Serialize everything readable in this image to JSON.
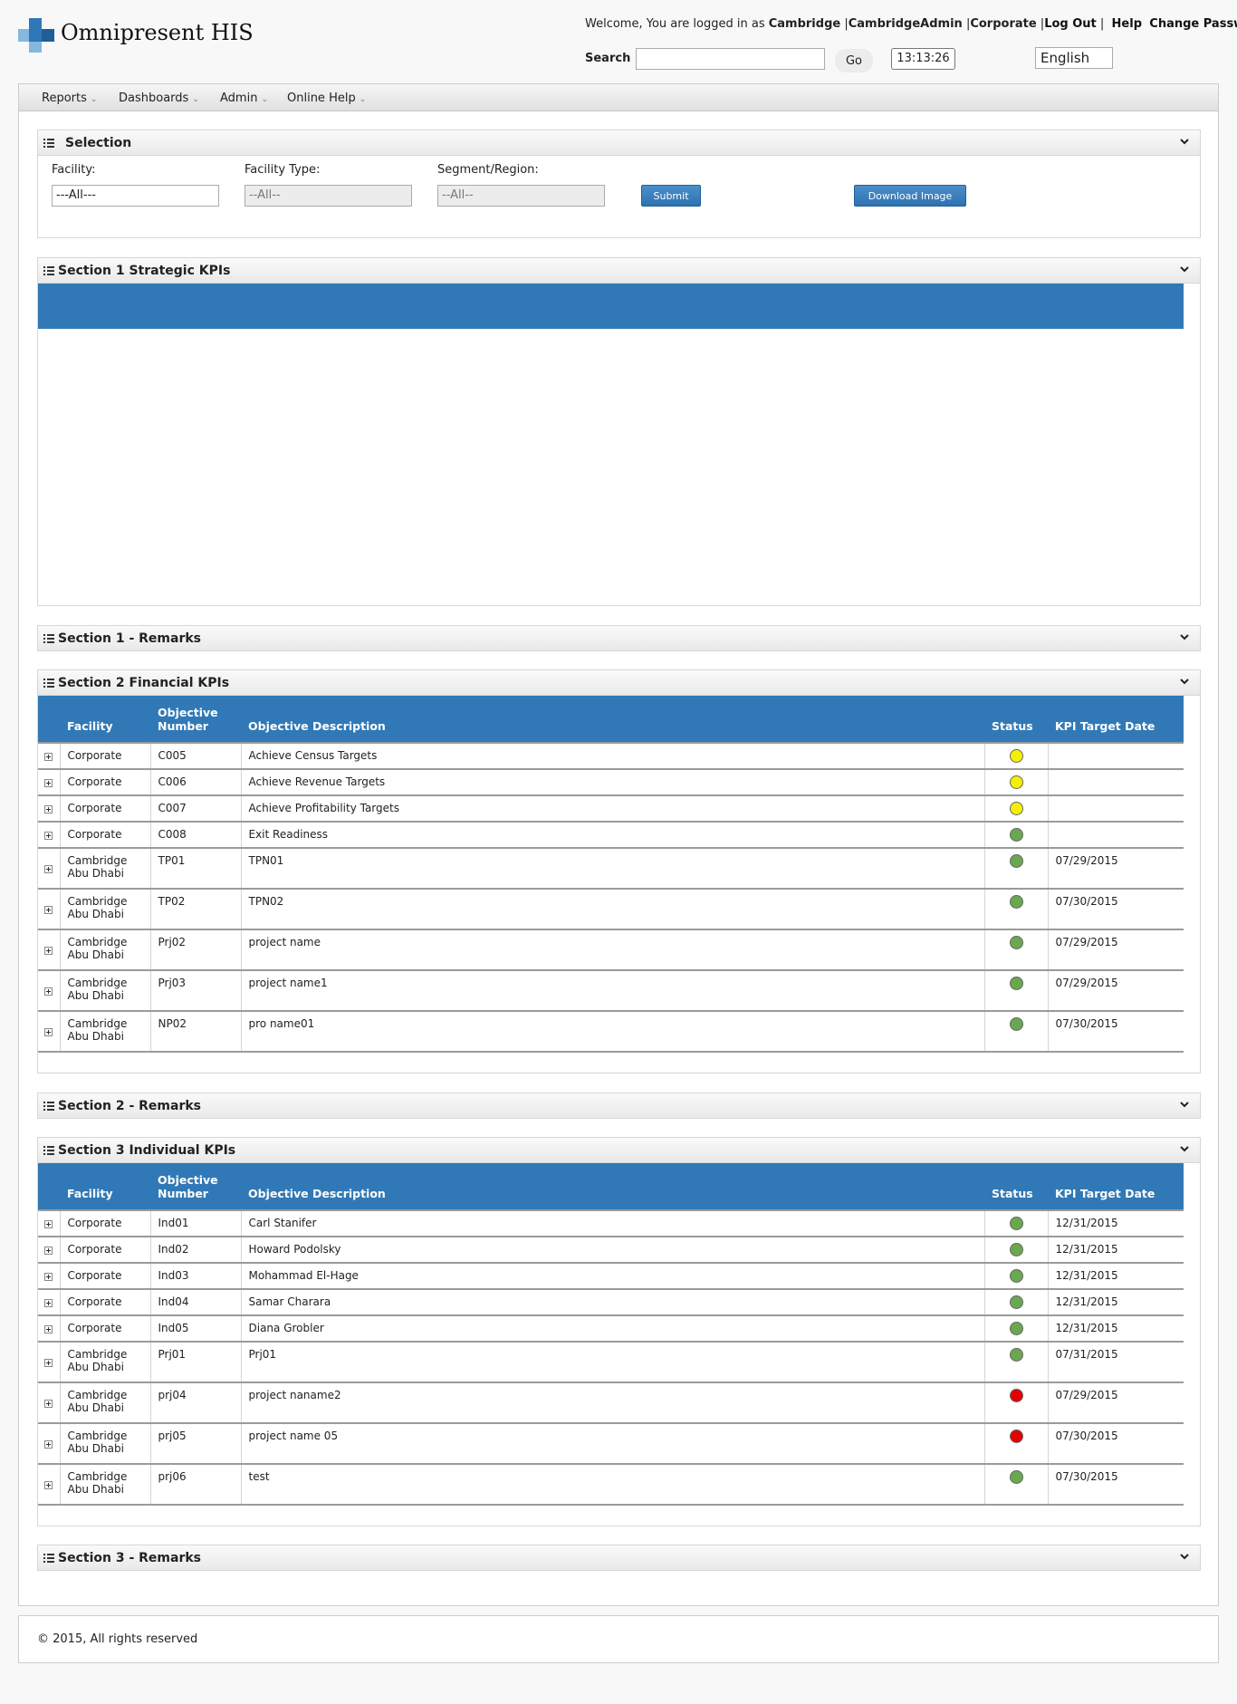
{
  "app": {
    "title": "Omnipresent HIS"
  },
  "user": {
    "welcome_prefix": "Welcome, You are logged in as ",
    "org": "Cambridge",
    "username": "CambridgeAdmin",
    "role": "Corporate",
    "logout": "Log Out",
    "help": "Help",
    "change_password": "Change Password"
  },
  "search": {
    "label": "Search",
    "value": "",
    "go": "Go"
  },
  "clock": "13:13:26",
  "language": "English",
  "nav": [
    {
      "label": "Reports"
    },
    {
      "label": "Dashboards"
    },
    {
      "label": "Admin"
    },
    {
      "label": "Online Help"
    }
  ],
  "selection": {
    "title": "Selection",
    "facility_label": "Facility:",
    "facility_value": "---All---",
    "type_label": "Facility Type:",
    "type_value": "--All--",
    "region_label": "Segment/Region:",
    "region_value": "--All--",
    "submit": "Submit",
    "download": "Download Image"
  },
  "sections": {
    "s1_title": "Section 1 Strategic KPIs",
    "s1_remarks": "Section 1 - Remarks",
    "s2_title": "Section 2 Financial KPIs",
    "s2_remarks": "Section 2 - Remarks",
    "s3_title": "Section 3 Individual KPIs",
    "s3_remarks": "Section 3 - Remarks"
  },
  "columns": {
    "facility": "Facility",
    "objective_number_1": "Objective",
    "objective_number_2": "Number",
    "description": "Objective Description",
    "status": "Status",
    "target_date": "KPI Target Date"
  },
  "colors": {
    "yellow": "#f4f000",
    "green": "#6aa84f",
    "red": "#e30000",
    "accent": "#3179b6"
  },
  "financial_rows": [
    {
      "facility1": "Corporate",
      "facility2": "",
      "number": "C005",
      "description": "Achieve Census Targets",
      "status": "yellow",
      "date": ""
    },
    {
      "facility1": "Corporate",
      "facility2": "",
      "number": "C006",
      "description": "Achieve Revenue Targets",
      "status": "yellow",
      "date": ""
    },
    {
      "facility1": "Corporate",
      "facility2": "",
      "number": "C007",
      "description": "Achieve Profitability Targets",
      "status": "yellow",
      "date": ""
    },
    {
      "facility1": "Corporate",
      "facility2": "",
      "number": "C008",
      "description": "Exit Readiness",
      "status": "green",
      "date": ""
    },
    {
      "facility1": "Cambridge",
      "facility2": "Abu Dhabi",
      "number": "TP01",
      "description": "TPN01",
      "status": "green",
      "date": "07/29/2015"
    },
    {
      "facility1": "Cambridge",
      "facility2": "Abu Dhabi",
      "number": "TP02",
      "description": "TPN02",
      "status": "green",
      "date": "07/30/2015"
    },
    {
      "facility1": "Cambridge",
      "facility2": "Abu Dhabi",
      "number": "Prj02",
      "description": "project name",
      "status": "green",
      "date": "07/29/2015"
    },
    {
      "facility1": "Cambridge",
      "facility2": "Abu Dhabi",
      "number": "Prj03",
      "description": "project name1",
      "status": "green",
      "date": "07/29/2015"
    },
    {
      "facility1": "Cambridge",
      "facility2": "Abu Dhabi",
      "number": "NP02",
      "description": "pro name01",
      "status": "green",
      "date": "07/30/2015"
    }
  ],
  "individual_rows": [
    {
      "facility1": "Corporate",
      "facility2": "",
      "number": "Ind01",
      "description": "Carl Stanifer",
      "status": "green",
      "date": "12/31/2015"
    },
    {
      "facility1": "Corporate",
      "facility2": "",
      "number": "Ind02",
      "description": "Howard Podolsky",
      "status": "green",
      "date": "12/31/2015"
    },
    {
      "facility1": "Corporate",
      "facility2": "",
      "number": "Ind03",
      "description": "Mohammad El-Hage",
      "status": "green",
      "date": "12/31/2015"
    },
    {
      "facility1": "Corporate",
      "facility2": "",
      "number": "Ind04",
      "description": "Samar Charara",
      "status": "green",
      "date": "12/31/2015"
    },
    {
      "facility1": "Corporate",
      "facility2": "",
      "number": "Ind05",
      "description": "Diana Grobler",
      "status": "green",
      "date": "12/31/2015"
    },
    {
      "facility1": "Cambridge",
      "facility2": "Abu Dhabi",
      "number": "Prj01",
      "description": "Prj01",
      "status": "green",
      "date": "07/31/2015"
    },
    {
      "facility1": "Cambridge",
      "facility2": "Abu Dhabi",
      "number": "prj04",
      "description": "project naname2",
      "status": "red",
      "date": "07/29/2015"
    },
    {
      "facility1": "Cambridge",
      "facility2": "Abu Dhabi",
      "number": "prj05",
      "description": "project name 05",
      "status": "red",
      "date": "07/30/2015"
    },
    {
      "facility1": "Cambridge",
      "facility2": "Abu Dhabi",
      "number": "prj06",
      "description": "test",
      "status": "green",
      "date": "07/30/2015"
    }
  ],
  "footer": "© 2015, All rights reserved"
}
